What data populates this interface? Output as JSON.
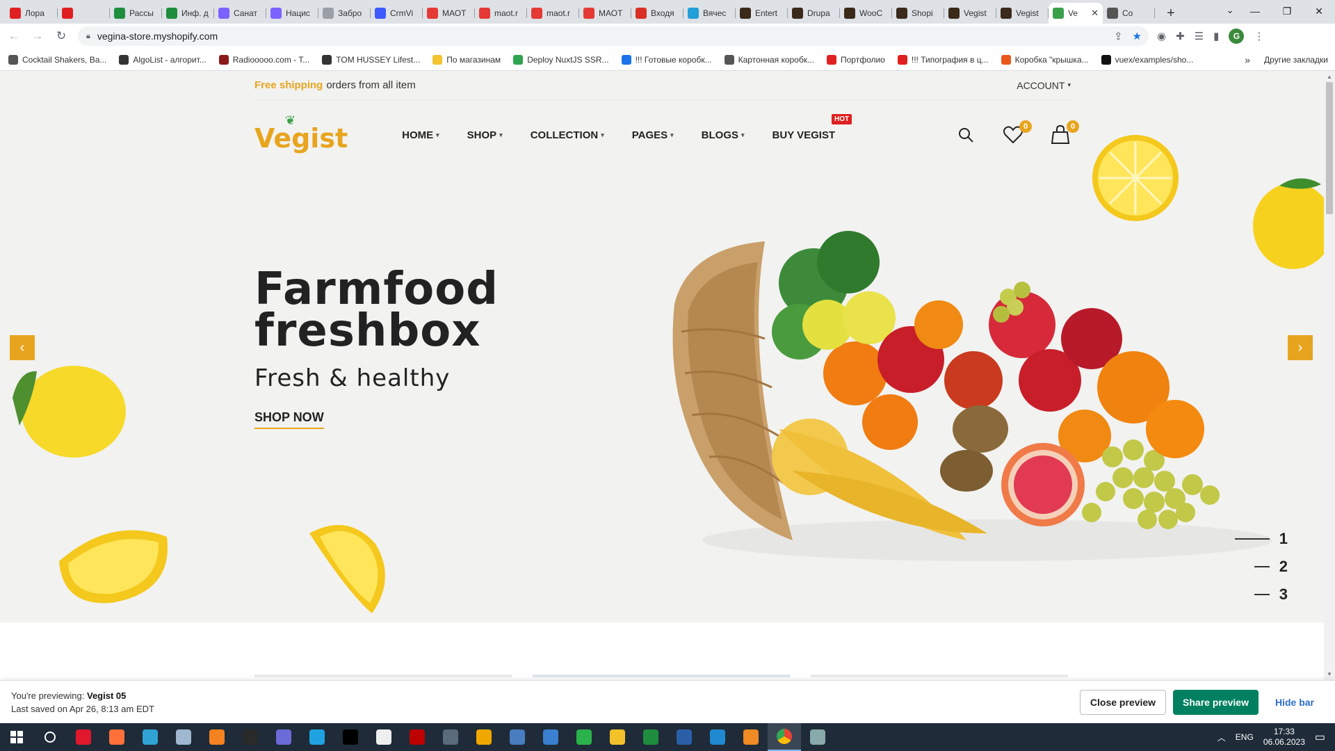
{
  "browser": {
    "tabs": [
      {
        "title": "Лора",
        "color": "#e02020"
      },
      {
        "title": "",
        "color": "#e02020"
      },
      {
        "title": "Рассы",
        "color": "#1e8e3e"
      },
      {
        "title": "Инф. д",
        "color": "#1e8e3e"
      },
      {
        "title": "Санат",
        "color": "#7b61ff"
      },
      {
        "title": "Нацис",
        "color": "#7b61ff"
      },
      {
        "title": "Забро",
        "color": "#9aa0a6"
      },
      {
        "title": "CrmVi",
        "color": "#3d5afe"
      },
      {
        "title": "МАОТ",
        "color": "#e53935"
      },
      {
        "title": "maot.r",
        "color": "#e53935"
      },
      {
        "title": "maot.r",
        "color": "#e53935"
      },
      {
        "title": "МАОТ",
        "color": "#e53935"
      },
      {
        "title": "Входя",
        "color": "#d93025"
      },
      {
        "title": "Вячес",
        "color": "#229ed9"
      },
      {
        "title": "Entert",
        "color": "#3b2a1a"
      },
      {
        "title": "Drupa",
        "color": "#3b2a1a"
      },
      {
        "title": "WooC",
        "color": "#3b2a1a"
      },
      {
        "title": "Shopi",
        "color": "#3b2a1a"
      },
      {
        "title": "Vegist",
        "color": "#3b2a1a"
      },
      {
        "title": "Vegist",
        "color": "#3b2a1a"
      },
      {
        "title": "Ve",
        "color": "#3aa04a",
        "active": true
      },
      {
        "title": "Co",
        "color": "#555"
      }
    ],
    "url": "vegina-store.myshopify.com",
    "bookmarks": [
      {
        "label": "Cocktail Shakers, Ba...",
        "color": "#555"
      },
      {
        "label": "AlgoList - алгорит...",
        "color": "#333"
      },
      {
        "label": "Radiooooo.com - T...",
        "color": "#8b1a1a"
      },
      {
        "label": "TOM HUSSEY Lifest...",
        "color": "#333"
      },
      {
        "label": "По магазинам",
        "color": "#f4c430"
      },
      {
        "label": "Deploy NuxtJS SSR...",
        "color": "#2ea44f"
      },
      {
        "label": "!!! Готовые коробк...",
        "color": "#1a73e8"
      },
      {
        "label": "Картонная коробк...",
        "color": "#555"
      },
      {
        "label": "Портфолио",
        "color": "#e02020"
      },
      {
        "label": "!!! Типография в ц...",
        "color": "#e02020"
      },
      {
        "label": "Коробка \"крышка...",
        "color": "#e8581a"
      },
      {
        "label": "vuex/examples/sho...",
        "color": "#111"
      }
    ],
    "bookmarks_other": "Другие закладки"
  },
  "store": {
    "announcement_highlight": "Free shipping",
    "announcement_text": "orders from all item",
    "account_label": "ACCOUNT",
    "logo_text": "Vegist",
    "nav": [
      {
        "label": "HOME",
        "has_dropdown": true
      },
      {
        "label": "SHOP",
        "has_dropdown": true
      },
      {
        "label": "COLLECTION",
        "has_dropdown": true
      },
      {
        "label": "PAGES",
        "has_dropdown": true
      },
      {
        "label": "BLOGS",
        "has_dropdown": true
      },
      {
        "label": "BUY VEGIST",
        "has_dropdown": false,
        "badge": "HOT"
      }
    ],
    "wishlist_count": "0",
    "cart_count": "0",
    "accent_color": "#e7a51f"
  },
  "hero": {
    "title_line1": "Farmfood",
    "title_line2": "freshbox",
    "subtitle": "Fresh & healthy",
    "cta": "SHOP NOW",
    "slides": [
      "1",
      "2",
      "3"
    ],
    "active_slide": "1"
  },
  "preview": {
    "previewing_label": "You're previewing:",
    "theme_name": "Vegist 05",
    "saved_text": "Last saved on Apr 26, 8:13 am EDT",
    "close_label": "Close preview",
    "share_label": "Share preview",
    "hide_label": "Hide bar"
  },
  "taskbar": {
    "language": "ENG",
    "time": "17:33",
    "date": "06.06.2023",
    "apps": [
      {
        "name": "search-icon",
        "color": "#fff"
      },
      {
        "name": "opera-icon",
        "color": "#e0182d"
      },
      {
        "name": "firefox-icon",
        "color": "#ff7139"
      },
      {
        "name": "app-icon",
        "color": "#2fa4d4"
      },
      {
        "name": "notepad-icon",
        "color": "#9fb8d0"
      },
      {
        "name": "headset-icon",
        "color": "#f58220"
      },
      {
        "name": "hs-icon",
        "color": "#2a2a2a"
      },
      {
        "name": "app-icon",
        "color": "#6b6bd8"
      },
      {
        "name": "edge-icon",
        "color": "#1fa3e0"
      },
      {
        "name": "terminal-icon",
        "color": "#000"
      },
      {
        "name": "dev-icon",
        "color": "#eee"
      },
      {
        "name": "filezilla-icon",
        "color": "#bf0000"
      },
      {
        "name": "calculator-icon",
        "color": "#5a6b7c"
      },
      {
        "name": "color-icon",
        "color": "#f0a800"
      },
      {
        "name": "network-icon",
        "color": "#4a7cc0"
      },
      {
        "name": "photos-icon",
        "color": "#3a7fd0"
      },
      {
        "name": "app-icon",
        "color": "#2bb24c"
      },
      {
        "name": "folder-icon",
        "color": "#f3c22b"
      },
      {
        "name": "sheet-icon",
        "color": "#1e8e3e"
      },
      {
        "name": "powershell-icon",
        "color": "#2a5fa8"
      },
      {
        "name": "vscode-icon",
        "color": "#1f8ad2"
      },
      {
        "name": "sublime-icon",
        "color": "#f08a24"
      },
      {
        "name": "chrome-icon",
        "color": "#4285f4",
        "active": true
      },
      {
        "name": "app-icon",
        "color": "#8aa"
      }
    ]
  }
}
